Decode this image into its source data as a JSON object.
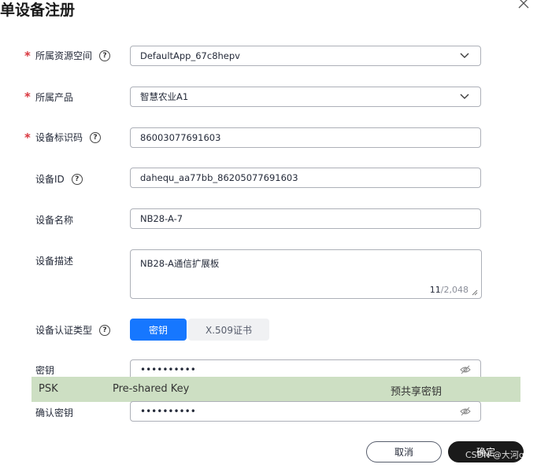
{
  "dialog": {
    "title": "单设备注册"
  },
  "form": {
    "resource_space": {
      "label": "所属资源空间",
      "value": "DefaultApp_67c8hepv"
    },
    "product": {
      "label": "所属产品",
      "value": "智慧农业A1"
    },
    "identifier": {
      "label": "设备标识码",
      "value": "86003077691603"
    },
    "device_id": {
      "label": "设备ID",
      "value": "dahequ_aa77bb_86205077691603"
    },
    "device_name": {
      "label": "设备名称",
      "value": "NB28-A-7"
    },
    "description": {
      "label": "设备描述",
      "value": "NB28-A通信扩展板",
      "count": "11",
      "max": "/2,048"
    },
    "auth_type": {
      "label": "设备认证类型",
      "options": [
        "密钥",
        "X.509证书"
      ],
      "selected": "密钥"
    },
    "secret": {
      "label": "密钥",
      "value": "••••••••••"
    },
    "confirm_secret": {
      "label": "确认密钥",
      "value": "••••••••••"
    }
  },
  "annotation": {
    "col1": "PSK",
    "col2": "Pre-shared Key",
    "col3": "预共享密钥"
  },
  "buttons": {
    "cancel": "取消",
    "ok": "确定"
  },
  "watermark": "CSDN @大河qu",
  "colors": {
    "required": "#d9363e",
    "primary": "#1677ff",
    "annotation_bg": "#cddfc3",
    "ok_button": "#1a1a1a"
  }
}
